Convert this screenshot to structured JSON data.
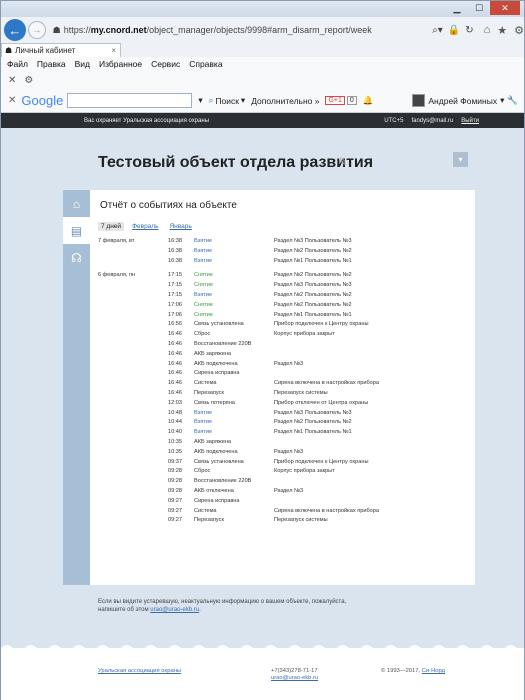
{
  "browser": {
    "url_protocol": "https://",
    "url_host": "my.cnord.net",
    "url_path": "/object_manager/objects/9998#arm_disarm_report/week",
    "tab_title": "Личный кабинет",
    "tab_close": "×",
    "menu": [
      "Файл",
      "Правка",
      "Вид",
      "Избранное",
      "Сервис",
      "Справка"
    ],
    "google_logo": "Google",
    "google_search_label": "Поиск",
    "google_more": "Дополнительно »",
    "google_plus": "G+1",
    "google_count": "0",
    "google_user": "Андрей Фоминых"
  },
  "site": {
    "header_left": "Вас охраняет Уральская ассоциация охраны",
    "timezone": "UTC+5",
    "email": "fandys@mail.ru",
    "logout": "Выйти"
  },
  "page": {
    "title": "Тестовый объект отдела развития",
    "card_title": "Отчёт о событиях на объекте",
    "ranges": [
      "7 дней",
      "Февраль",
      "Январь"
    ],
    "events": [
      {
        "date": "7 февраля, вт",
        "time": "16:38",
        "event": "Взятие",
        "color": "blue",
        "desc": "Раздел №3 Пользователь №3"
      },
      {
        "date": "",
        "time": "16:38",
        "event": "Взятие",
        "color": "blue",
        "desc": "Раздел №2 Пользователь №2"
      },
      {
        "date": "",
        "time": "16:38",
        "event": "Взятие",
        "color": "blue",
        "desc": "Раздел №1 Пользователь №1"
      },
      {
        "gap": true
      },
      {
        "date": "6 февраля, пн",
        "time": "17:15",
        "event": "Снятие",
        "color": "green",
        "desc": "Раздел №2 Пользователь №2"
      },
      {
        "date": "",
        "time": "17:15",
        "event": "Снятие",
        "color": "green",
        "desc": "Раздел №3 Пользователь №3"
      },
      {
        "date": "",
        "time": "17:15",
        "event": "Взятие",
        "color": "blue",
        "desc": "Раздел №2 Пользователь №2"
      },
      {
        "date": "",
        "time": "17:06",
        "event": "Снятие",
        "color": "green",
        "desc": "Раздел №2 Пользователь №2"
      },
      {
        "date": "",
        "time": "17:06",
        "event": "Снятие",
        "color": "green",
        "desc": "Раздел №1 Пользователь №1"
      },
      {
        "date": "",
        "time": "16:56",
        "event": "Связь установлена",
        "color": "",
        "desc": "Прибор подключен к Центру охраны"
      },
      {
        "date": "",
        "time": "16:46",
        "event": "Сброс",
        "color": "",
        "desc": "Корпус прибора закрыт"
      },
      {
        "date": "",
        "time": "16:46",
        "event": "Восстановление 220В",
        "color": "",
        "desc": ""
      },
      {
        "date": "",
        "time": "16:46",
        "event": "АКБ заряжена",
        "color": "",
        "desc": ""
      },
      {
        "date": "",
        "time": "16:46",
        "event": "АКБ подключена",
        "color": "",
        "desc": "Раздел №3"
      },
      {
        "date": "",
        "time": "16:46",
        "event": "Сирена исправна",
        "color": "",
        "desc": ""
      },
      {
        "date": "",
        "time": "16:46",
        "event": "Система",
        "color": "",
        "desc": "Сирена включена в настройках прибора"
      },
      {
        "date": "",
        "time": "16:46",
        "event": "Перезапуск",
        "color": "",
        "desc": "Перезапуск системы"
      },
      {
        "date": "",
        "time": "12:03",
        "event": "Связь потеряна",
        "color": "",
        "desc": "Прибор отключен от Центра охраны"
      },
      {
        "date": "",
        "time": "10:48",
        "event": "Взятие",
        "color": "blue",
        "desc": "Раздел №3 Пользователь №3"
      },
      {
        "date": "",
        "time": "10:44",
        "event": "Взятие",
        "color": "blue",
        "desc": "Раздел №2 Пользователь №2"
      },
      {
        "date": "",
        "time": "10:40",
        "event": "Взятие",
        "color": "blue",
        "desc": "Раздел №1 Пользователь №1"
      },
      {
        "date": "",
        "time": "10:35",
        "event": "АКБ заряжена",
        "color": "",
        "desc": ""
      },
      {
        "date": "",
        "time": "10:35",
        "event": "АКБ подключена",
        "color": "",
        "desc": "Раздел №3"
      },
      {
        "date": "",
        "time": "09:37",
        "event": "Связь установлена",
        "color": "",
        "desc": "Прибор подключен к Центру охраны"
      },
      {
        "date": "",
        "time": "09:28",
        "event": "Сброс",
        "color": "",
        "desc": "Корпус прибора закрыт"
      },
      {
        "date": "",
        "time": "09:28",
        "event": "Восстановление 220В",
        "color": "",
        "desc": ""
      },
      {
        "date": "",
        "time": "09:28",
        "event": "АКБ отключена",
        "color": "",
        "desc": "Раздел №3"
      },
      {
        "date": "",
        "time": "09:27",
        "event": "Сирена исправна",
        "color": "",
        "desc": ""
      },
      {
        "date": "",
        "time": "09:27",
        "event": "Система",
        "color": "",
        "desc": "Сирена включена в настройках прибора"
      },
      {
        "date": "",
        "time": "09:27",
        "event": "Перезапуск",
        "color": "",
        "desc": "Перезапуск системы"
      }
    ],
    "note_text": "Если вы видите устаревшую, неактуальную информацию о вашем объекте, пожалуйста, напишите об этом",
    "note_email": "urao@urao-ekb.ru"
  },
  "footer": {
    "org": "Уральская ассоциация охраны",
    "phone": "+7(343)278-71-17",
    "email": "urao@urao-ekb.ru",
    "copyright": "© 1993—2017,",
    "copyright_link": "Си-Норд"
  },
  "colors": {
    "blue": "#3a6db0",
    "green": "#3a9a3a",
    "header": "#2b2e33"
  }
}
